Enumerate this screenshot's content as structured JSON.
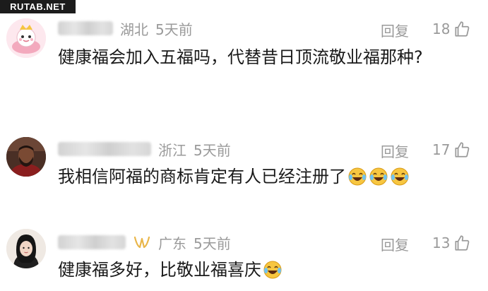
{
  "watermark": "RUTAB.NET",
  "reply_label": "回复",
  "comments": [
    {
      "region": "湖北",
      "time": "5天前",
      "likes": "18",
      "text": "健康福会加入五福吗，代替昔日顶流敬业福那种?"
    },
    {
      "region": "浙江",
      "time": "5天前",
      "likes": "17",
      "text": "我相信阿福的商标肯定有人已经注册了"
    },
    {
      "region": "广东",
      "time": "5天前",
      "likes": "13",
      "text": "健康福多好，比敬业福喜庆"
    }
  ],
  "icons": {
    "like": "thumbs-up-icon",
    "emoji": "laughing-tears-emoji"
  }
}
